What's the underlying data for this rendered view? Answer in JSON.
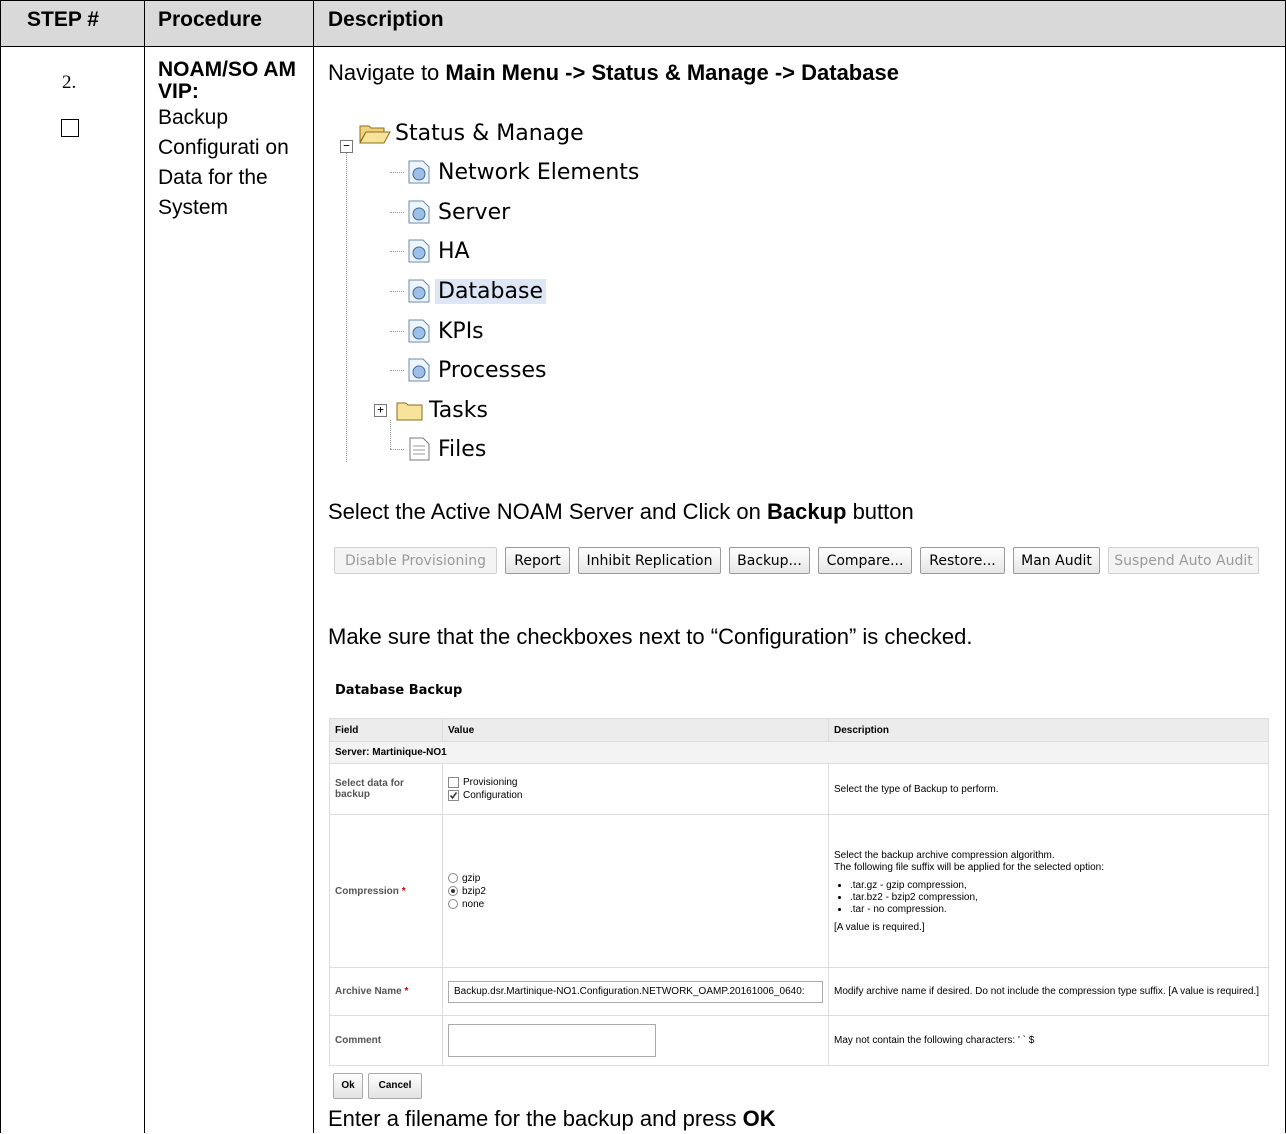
{
  "table_header": {
    "step": "STEP #",
    "procedure": "Procedure",
    "description": "Description"
  },
  "step": {
    "number": "2.",
    "procedure_title": "NOAM/SO AM VIP:",
    "procedure_text": "Backup Configurati on Data for the System"
  },
  "instr1": {
    "prefix": "Navigate to ",
    "path": "Main Menu -> Status & Manage -> Database"
  },
  "tree": {
    "root": "Status & Manage",
    "items": [
      "Network Elements",
      "Server",
      "HA",
      "Database",
      "KPIs",
      "Processes"
    ],
    "tasks": "Tasks",
    "files": "Files"
  },
  "instr2": {
    "prefix": "Select the Active NOAM Server and Click on ",
    "bold": "Backup",
    "suffix": " button"
  },
  "toolbar": {
    "disable_provisioning": "Disable Provisioning",
    "report": "Report",
    "inhibit_replication": "Inhibit Replication",
    "backup": "Backup...",
    "compare": "Compare...",
    "restore": "Restore...",
    "man_audit": "Man Audit",
    "suspend_auto_audit": "Suspend Auto Audit"
  },
  "instr3": "Make sure that the checkboxes next to “Configuration” is checked.",
  "form": {
    "title": "Database Backup",
    "col_field": "Field",
    "col_value": "Value",
    "col_description": "Description",
    "server": "Server: Martinique-NO1",
    "select_label": "Select data for backup",
    "opt_provisioning": "Provisioning",
    "opt_configuration": "Configuration",
    "select_desc": "Select the type of Backup to perform.",
    "compression_label": "Compression",
    "required_mark": "*",
    "gzip": "gzip",
    "bzip2": "bzip2",
    "none": "none",
    "compression_desc1": "Select the backup archive compression algorithm.",
    "compression_desc2": "The following file suffix will be applied for the selected option:",
    "suffix_items": [
      ".tar.gz - gzip compression,",
      ".tar.bz2 - bzip2 compression,",
      ".tar - no compression."
    ],
    "required_note": "[A value is required.]",
    "archive_label": "Archive Name",
    "archive_value": "Backup.dsr.Martinique-NO1.Configuration.NETWORK_OAMP.20161006_0640:",
    "archive_desc": "Modify archive name if desired. Do not include the compression type suffix. [A value is required.]",
    "comment_label": "Comment",
    "comment_value": "",
    "comment_desc": "May not contain the following characters: ' ` $",
    "ok": "Ok",
    "cancel": "Cancel"
  },
  "instr4": {
    "prefix": "Enter a filename for the backup and press ",
    "bold": "OK"
  }
}
